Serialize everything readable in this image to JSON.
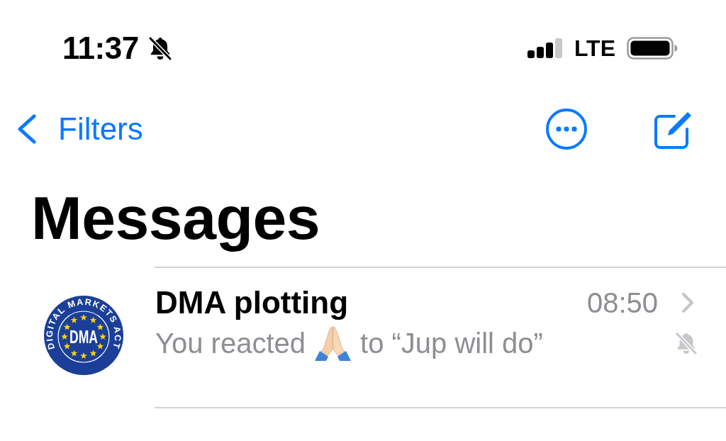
{
  "status_bar": {
    "time": "11:37",
    "silent": true,
    "network": "LTE"
  },
  "nav_bar": {
    "back_label": "Filters"
  },
  "title": "Messages",
  "conversations": [
    {
      "avatar": {
        "ring_text": "DIGITAL MARKETS ACT",
        "center_text": "DMA"
      },
      "name": "DMA plotting",
      "time": "08:50",
      "preview": {
        "before": "You reacted",
        "after": "to “Jup will do”"
      },
      "muted": true
    }
  ]
}
